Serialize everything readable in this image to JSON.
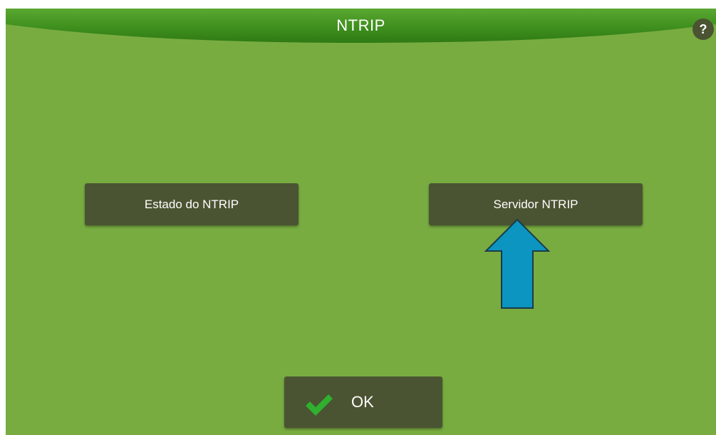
{
  "header": {
    "title": "NTRIP",
    "help_label": "?"
  },
  "menu": {
    "estado_label": "Estado do NTRIP",
    "servidor_label": "Servidor NTRIP"
  },
  "footer": {
    "ok_label": "OK"
  },
  "icons": {
    "help": "question-mark-icon",
    "ok": "checkmark-icon",
    "callout": "up-arrow-icon"
  },
  "colors": {
    "background": "#78ac41",
    "header": "#3f8f1e",
    "button": "#4a5432",
    "checkmark": "#2fb02f",
    "arrow_fill": "#0b95c0",
    "arrow_stroke": "#1b3a4a"
  }
}
